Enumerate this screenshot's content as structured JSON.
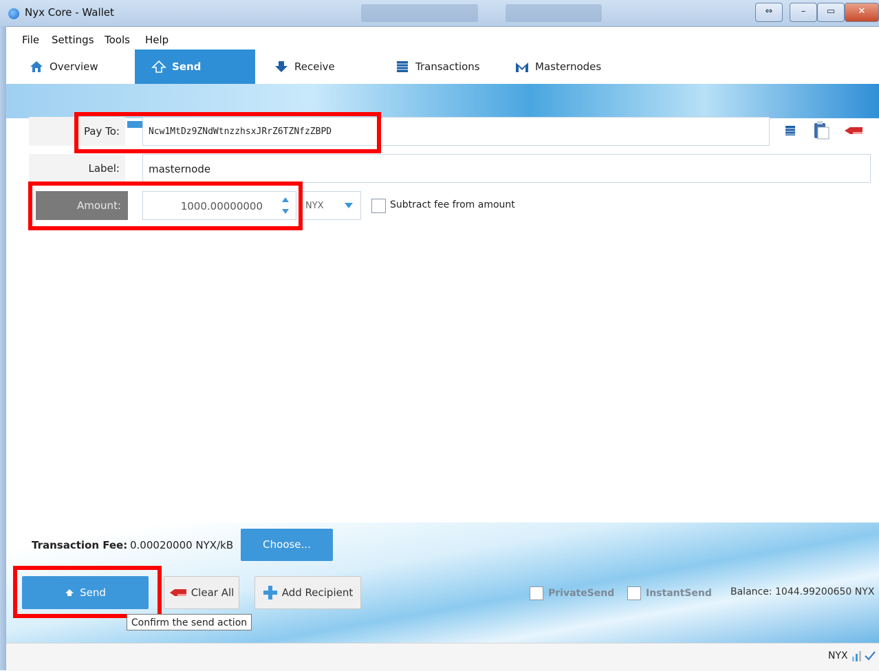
{
  "window": {
    "title": "Nyx Core - Wallet"
  },
  "menu": [
    "File",
    "Settings",
    "Tools",
    "Help"
  ],
  "tabs": [
    {
      "label": "Overview"
    },
    {
      "label": "Send"
    },
    {
      "label": "Receive"
    },
    {
      "label": "Transactions"
    },
    {
      "label": "Masternodes"
    }
  ],
  "form": {
    "pay_to_label": "Pay To:",
    "pay_to_value": "Ncw1MtDz9ZNdWtnzzhsxJRrZ6TZNfzZBPD",
    "label_label": "Label:",
    "label_value": "masternode",
    "amount_label": "Amount:",
    "amount_value": "1000.00000000",
    "unit": "NYX",
    "subtract_fee_label": "Subtract fee from amount"
  },
  "fee": {
    "label": "Transaction Fee:",
    "value": "0.00020000 NYX/kB",
    "choose_label": "Choose..."
  },
  "actions": {
    "send_label": "Send",
    "clear_all_label": "Clear All",
    "add_recipient_label": "Add Recipient",
    "tooltip": "Confirm the send action",
    "private_send_label": "PrivateSend",
    "instant_send_label": "InstantSend",
    "balance": "Balance: 1044.99200650 NYX"
  },
  "status": {
    "unit": "NYX"
  },
  "colors": {
    "accent": "#2f8fd6",
    "highlight": "#ff0000"
  }
}
